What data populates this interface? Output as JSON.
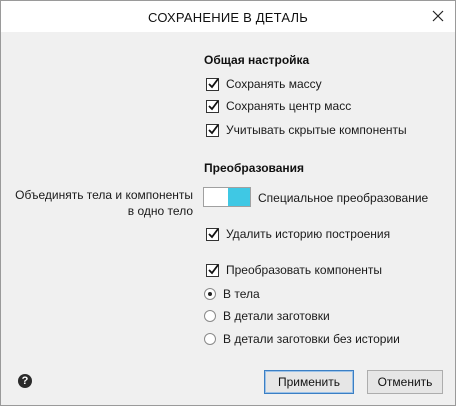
{
  "dialog": {
    "title": "СОХРАНЕНИЕ В ДЕТАЛЬ",
    "close_icon": "close-icon"
  },
  "general": {
    "heading": "Общая настройка",
    "options": [
      {
        "label": "Сохранять массу",
        "checked": true
      },
      {
        "label": "Сохранять центр масс",
        "checked": true
      },
      {
        "label": "Учитывать скрытые компоненты",
        "checked": true
      }
    ]
  },
  "transform": {
    "heading": "Преобразования",
    "merge_label_line1": "Объединять тела и компоненты",
    "merge_label_line2": "в одно тело",
    "toggle_label": "Специальное преобразование",
    "toggle_on": true,
    "toggle_color": "#3fc8e4",
    "delete_history": {
      "label": "Удалить историю построения",
      "checked": true
    },
    "convert_components": {
      "label": "Преобразовать компоненты",
      "checked": true
    },
    "radios": [
      {
        "label": "В тела",
        "selected": true
      },
      {
        "label": "В детали заготовки",
        "selected": false
      },
      {
        "label": "В детали заготовки без истории",
        "selected": false
      }
    ]
  },
  "footer": {
    "help_icon": "help-icon",
    "help_glyph": "?",
    "apply_label": "Применить",
    "cancel_label": "Отменить"
  }
}
